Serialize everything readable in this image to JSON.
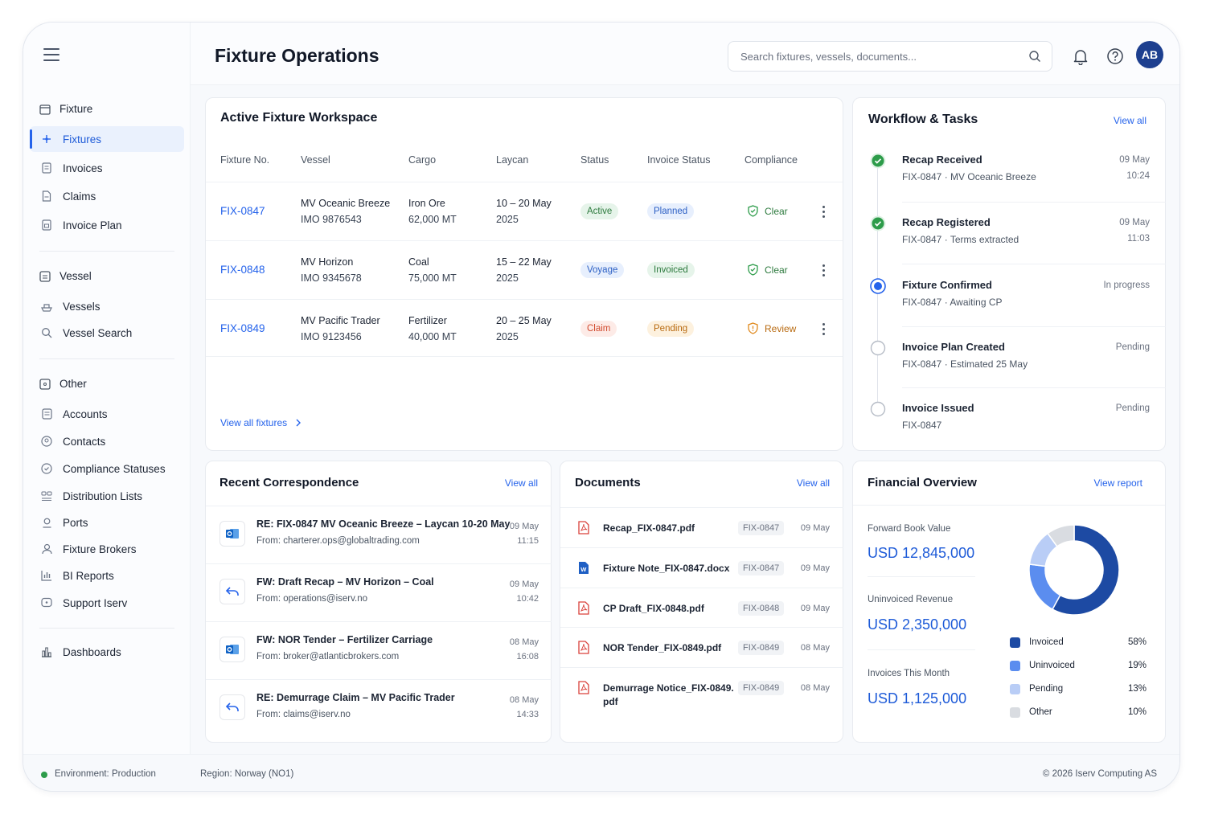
{
  "app": {
    "title": "Fixture Operations"
  },
  "search": {
    "placeholder": "Search fixtures, vessels, documents..."
  },
  "user": {
    "initials": "AB"
  },
  "icons": {
    "menu": "hamburger-icon",
    "search": "search-icon",
    "notifications": "bell-icon",
    "help": "help-icon"
  },
  "colors": {
    "accent": "#2563eb",
    "brand_dark": "#1d3f8f",
    "active_green": "#2d9c4a",
    "invoiced": "#1d4aa3",
    "uninvoiced": "#5b8def",
    "pending": "#b9cdf6",
    "other": "#d9dce1"
  },
  "sidebar": {
    "fixture_group": "Fixture",
    "fixture_items": [
      {
        "label": "Fixtures",
        "active": true
      },
      {
        "label": "Invoices"
      },
      {
        "label": "Claims"
      },
      {
        "label": "Invoice Plan"
      }
    ],
    "vessel_group": "Vessel",
    "vessel_items": [
      {
        "label": "Vessels"
      },
      {
        "label": "Vessel Search"
      }
    ],
    "other_group": "Other",
    "other_items": [
      {
        "label": "Accounts"
      },
      {
        "label": "Contacts"
      },
      {
        "label": "Compliance Statuses"
      },
      {
        "label": "Distribution Lists"
      },
      {
        "label": "Ports"
      },
      {
        "label": "Fixture Brokers"
      },
      {
        "label": "BI Reports"
      },
      {
        "label": "Support Iserv"
      }
    ],
    "dashboards": "Dashboards"
  },
  "workspace": {
    "title": "Active Fixture Workspace",
    "columns": [
      "Fixture No.",
      "Vessel",
      "Cargo",
      "Laycan",
      "Status",
      "Invoice Status",
      "Compliance"
    ],
    "rows": [
      {
        "fixture": "FIX-0847",
        "vessel": "MV Oceanic Breeze",
        "imo": "IMO 9876543",
        "cargo": "Iron Ore",
        "qty": "62,000 MT",
        "laycan": "10 – 20 May",
        "year": "2025",
        "status": "Active",
        "invoice": "Planned",
        "compliance": "Clear"
      },
      {
        "fixture": "FIX-0848",
        "vessel": "MV Horizon",
        "imo": "IMO 9345678",
        "cargo": "Coal",
        "qty": "75,000 MT",
        "laycan": "15 – 22 May",
        "year": "2025",
        "status": "Voyage",
        "invoice": "Invoiced",
        "compliance": "Clear"
      },
      {
        "fixture": "FIX-0849",
        "vessel": "MV Pacific Trader",
        "imo": "IMO 9123456",
        "cargo": "Fertilizer",
        "qty": "40,000 MT",
        "laycan": "20 – 25 May",
        "year": "2025",
        "status": "Claim",
        "invoice": "Pending",
        "compliance": "Review"
      }
    ],
    "view_all": "View all fixtures"
  },
  "workflow": {
    "title": "Workflow & Tasks",
    "view_all": "View all",
    "tasks": [
      {
        "title": "Recap Received",
        "fixture": "FIX-0847",
        "sep": "·",
        "detail": "MV Oceanic Breeze",
        "date": "09 May",
        "time": "10:24",
        "state": "done"
      },
      {
        "title": "Recap Registered",
        "fixture": "FIX-0847",
        "sep": "·",
        "detail": "Terms extracted",
        "date": "09 May",
        "time": "11:03",
        "state": "done"
      },
      {
        "title": "Fixture Confirmed",
        "fixture": "FIX-0847",
        "sep": "·",
        "detail": "Awaiting CP",
        "date": "In progress",
        "state": "current"
      },
      {
        "title": "Invoice Plan Created",
        "fixture": "FIX-0847",
        "sep": "·",
        "detail": "Estimated 25 May",
        "date": "Pending",
        "state": "pending"
      },
      {
        "title": "Invoice Issued",
        "fixture": "FIX-0847",
        "date": "Pending",
        "state": "pending"
      }
    ]
  },
  "correspondence": {
    "title": "Recent Correspondence",
    "view_all": "View all",
    "items": [
      {
        "subject": "RE: FIX-0847 MV Oceanic Breeze – Laycan 10-20 May",
        "from": "From: charterer.ops@globaltrading.com",
        "date": "09 May",
        "time": "11:15",
        "icon": "outlook-icon"
      },
      {
        "subject": "FW: Draft Recap – MV Horizon – Coal",
        "from": "From: operations@iserv.no",
        "date": "09 May",
        "time": "10:42",
        "icon": "reply-icon"
      },
      {
        "subject": "FW: NOR Tender – Fertilizer Carriage",
        "from": "From: broker@atlanticbrokers.com",
        "date": "08 May",
        "time": "16:08",
        "icon": "outlook-icon"
      },
      {
        "subject": "RE: Demurrage Claim – MV Pacific Trader",
        "from": "From: claims@iserv.no",
        "date": "08 May",
        "time": "14:33",
        "icon": "reply-icon"
      }
    ]
  },
  "documents": {
    "title": "Documents",
    "view_all": "View all",
    "items": [
      {
        "name": "Recap_FIX-0847.pdf",
        "tag": "FIX-0847",
        "date": "09 May",
        "type": "pdf"
      },
      {
        "name": "Fixture Note_FIX-0847.docx",
        "tag": "FIX-0847",
        "date": "09 May",
        "type": "docx"
      },
      {
        "name": "CP Draft_FIX-0848.pdf",
        "tag": "FIX-0848",
        "date": "09 May",
        "type": "pdf"
      },
      {
        "name": "NOR Tender_FIX-0849.pdf",
        "tag": "FIX-0849",
        "date": "08 May",
        "type": "pdf"
      },
      {
        "name": "Demurrage Notice_FIX-0849.",
        "name2": "pdf",
        "tag": "FIX-0849",
        "date": "08 May",
        "type": "pdf"
      }
    ]
  },
  "financial": {
    "title": "Financial Overview",
    "view_report": "View report",
    "metrics": [
      {
        "label": "Forward Book Value",
        "value": "USD 12,845,000"
      },
      {
        "label": "Uninvoiced Revenue",
        "value": "USD 2,350,000"
      },
      {
        "label": "Invoices This Month",
        "value": "USD 1,125,000"
      }
    ]
  },
  "chart_data": {
    "type": "pie",
    "categories": [
      "Invoiced",
      "Uninvoiced",
      "Pending",
      "Other"
    ],
    "values": [
      58,
      19,
      13,
      10
    ],
    "labels": [
      "58%",
      "19%",
      "13%",
      "10%"
    ]
  },
  "footer": {
    "environment": "Environment: Production",
    "region": "Region: Norway (NO1)",
    "copyright": "© 2026 Iserv Computing AS"
  }
}
